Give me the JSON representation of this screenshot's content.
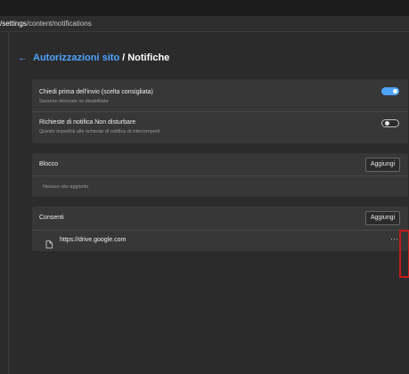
{
  "address_bar": {
    "host": "/settings",
    "path": "/content/notifications"
  },
  "header": {
    "back_link": "Autorizzazioni sito",
    "separator": "/",
    "current": "Notifiche"
  },
  "settings": [
    {
      "title": "Chiedi prima dell'invio (scelta consigliata)",
      "description": "Saranno bloccate se disabilitate",
      "enabled": true
    },
    {
      "title": "Richieste di notifica Non disturbare",
      "description": "Questo impedirà alle richieste di notifica di interromperti",
      "enabled": false
    }
  ],
  "blocco": {
    "title": "Blocco",
    "add_label": "Aggiungi",
    "empty_text": "Nessun sito aggiunto"
  },
  "consenti": {
    "title": "Consenti",
    "add_label": "Aggiungi",
    "sites": [
      {
        "url": "https://drive.google.com",
        "more": "···"
      }
    ]
  },
  "icons": {
    "back": "arrow-left-icon",
    "site": "file-icon",
    "more": "more-icon"
  },
  "colors": {
    "accent": "#4ea4ff",
    "highlight": "#c81919",
    "background": "#2b2b2b",
    "card": "#373737"
  }
}
